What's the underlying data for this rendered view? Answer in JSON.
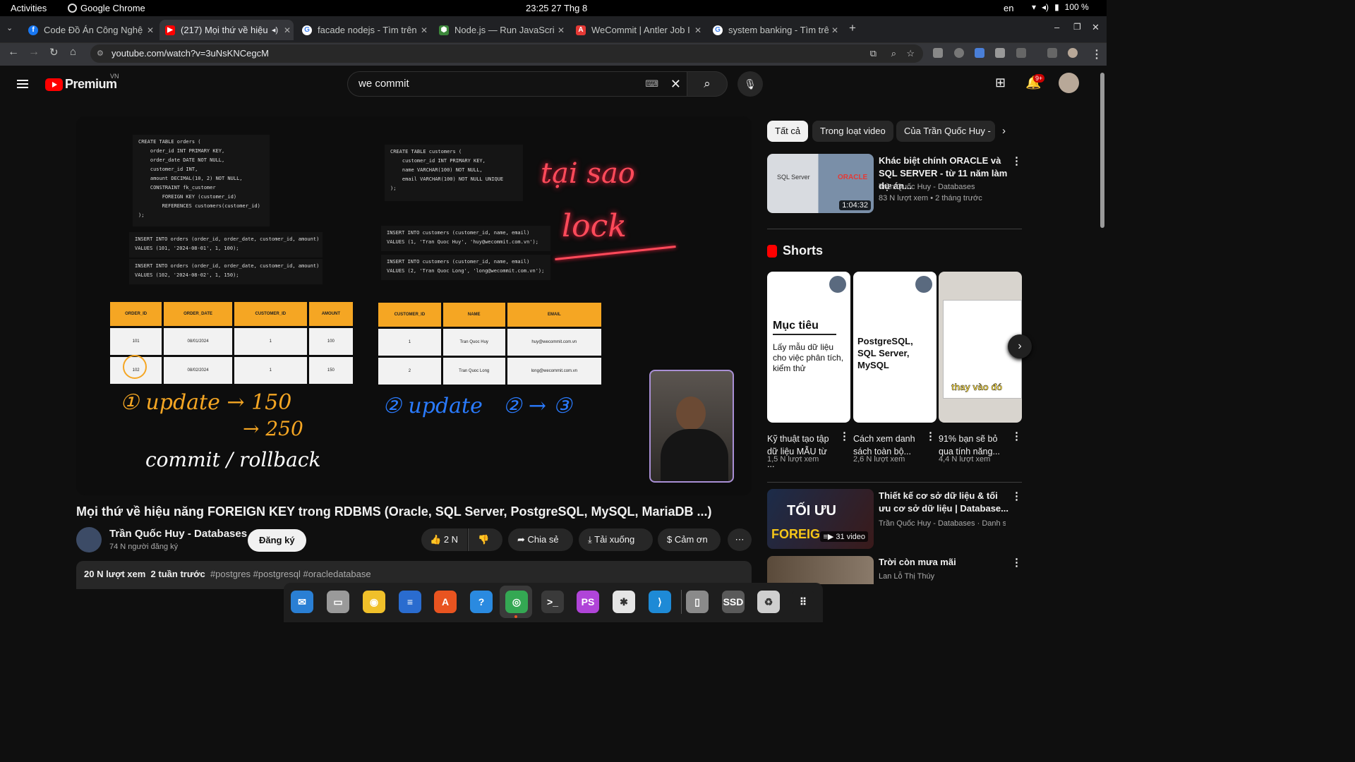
{
  "topbar": {
    "activities": "Activities",
    "app_name": "Google Chrome",
    "clock": "23:25  27 Thg 8",
    "lang": "en",
    "battery": "100 %"
  },
  "tabs": [
    {
      "title": "Code Đồ Án Công Nghệ",
      "favicon": "facebook-icon",
      "color": "#1877f2"
    },
    {
      "title": "(217) Mọi thứ về hiệu",
      "favicon": "youtube-icon",
      "color": "#ff0000"
    },
    {
      "title": "facade nodejs - Tìm trên",
      "favicon": "google-icon",
      "color": "#4285f4"
    },
    {
      "title": "Node.js — Run JavaScrip",
      "favicon": "nodejs-icon",
      "color": "#3c873a"
    },
    {
      "title": "WeCommit | Antler Job I",
      "favicon": "antler-icon",
      "color": "#e53935"
    },
    {
      "title": "system banking - Tìm trê",
      "favicon": "google-icon",
      "color": "#4285f4"
    }
  ],
  "address": {
    "url": "youtube.com/watch?v=3uNsKNCegcM"
  },
  "yt": {
    "brand": "Premium",
    "country": "VN",
    "search_value": "we commit",
    "notif_count": "9+"
  },
  "player": {
    "sql_orders": "CREATE TABLE orders (\n    order_id INT PRIMARY KEY,\n    order_date DATE NOT NULL,\n    customer_id INT,\n    amount DECIMAL(10, 2) NOT NULL,\n    CONSTRAINT fk_customer\n        FOREIGN KEY (customer_id)\n        REFERENCES customers(customer_id)\n);",
    "sql_customers": "CREATE TABLE customers (\n    customer_id INT PRIMARY KEY,\n    name VARCHAR(100) NOT NULL,\n    email VARCHAR(100) NOT NULL UNIQUE\n);",
    "insert_orders_1": "INSERT INTO orders (order_id, order_date, customer_id, amount)\nVALUES (101, '2024-08-01', 1, 100);",
    "insert_orders_2": "INSERT INTO orders (order_id, order_date, customer_id, amount)\nVALUES (102, '2024-08-02', 1, 150);",
    "insert_customers_1": "INSERT INTO customers (customer_id, name, email)\nVALUES (1, 'Tran Quoc Huy', 'huy@wecommit.com.vn');",
    "insert_customers_2": "INSERT INTO customers (customer_id, name, email)\nVALUES (2, 'Tran Quoc Long', 'long@wecommit.com.vn');",
    "orders_headers": [
      "ORDER_ID",
      "ORDER_DATE",
      "CUSTOMER_ID",
      "AMOUNT"
    ],
    "orders_rows": [
      [
        "101",
        "08/01/2024",
        "1",
        "100"
      ],
      [
        "102",
        "08/02/2024",
        "1",
        "150"
      ]
    ],
    "customers_headers": [
      "CUSTOMER_ID",
      "NAME",
      "EMAIL"
    ],
    "customers_rows": [
      [
        "1",
        "Tran Quoc Huy",
        "huy@wecommit.com.vn"
      ],
      [
        "2",
        "Tran Quoc Long",
        "long@wecommit.com.vn"
      ]
    ],
    "handwriting": {
      "red_1": "tại sao",
      "red_2": "lock",
      "orange_1": "① update → 150",
      "orange_2": "→ 250",
      "white": "commit / rollback",
      "blue": "② update   ② → ③"
    }
  },
  "video": {
    "title": "Mọi thứ về hiệu năng FOREIGN KEY trong RDBMS (Oracle, SQL Server, PostgreSQL, MySQL, MariaDB ...)",
    "channel": "Trần Quốc Huy - Databases",
    "subscribers": "74 N người đăng ký",
    "subscribe_label": "Đăng ký",
    "likes": "2 N",
    "share": "Chia sẻ",
    "download": "Tải xuống",
    "thanks": "Cảm ơn",
    "views": "20 N lượt xem",
    "when": "2 tuần trước",
    "hashtags": "#postgres #postgresql #oracledatabase"
  },
  "chips": [
    "Tất cả",
    "Trong loạt video",
    "Của Trần Quốc Huy - "
  ],
  "rec1": {
    "title": "Khác biệt chính ORACLE và SQL SERVER - từ 11 năm làm dự án...",
    "channel": "Trần Quốc Huy - Databases",
    "meta": "83 N lượt xem  •  2 tháng trước",
    "duration": "1:04:32",
    "thumb_left": "SQL Server",
    "thumb_right": "ORACLE"
  },
  "shorts": {
    "heading": "Shorts",
    "items": [
      {
        "card_title": "Mục tiêu",
        "card_body": "Lấy mẫu dữ liệu cho việc phân tích, kiểm thử",
        "title": "Kỹ thuật tạo tập dữ liệu MẪU từ ...",
        "views": "1,5 N lượt xem"
      },
      {
        "card_title": "PostgreSQL, SQL Server, MySQL",
        "card_body": "",
        "title": "Cách xem danh sách toàn bộ...",
        "views": "2,6 N lượt xem"
      },
      {
        "card_title": "thay vào đó",
        "card_body": "",
        "title": "91% bạn sẽ bỏ qua tính năng...",
        "views": "4,4 N lượt xem"
      }
    ]
  },
  "rec2": {
    "title": "Thiết kế cơ sở dữ liệu & tối ưu cơ sở dữ liệu | Database...",
    "meta": "Trần Quốc Huy - Databases · Danh s...",
    "count": "31 video",
    "thumb_text1": "TỐI ƯU",
    "thumb_text2": "FOREIG"
  },
  "rec3": {
    "title": "Trời còn mưa mãi",
    "meta": "Lan Lỗ Thị Thúy"
  },
  "dock": [
    {
      "name": "thunderbird-icon",
      "color": "#2a7fd4",
      "glyph": "✉"
    },
    {
      "name": "files-icon",
      "color": "#9a9a9a",
      "glyph": "▭"
    },
    {
      "name": "rhythmbox-icon",
      "color": "#f0c02a",
      "glyph": "◉"
    },
    {
      "name": "writer-icon",
      "color": "#2a6ccf",
      "glyph": "≡"
    },
    {
      "name": "app-center-icon",
      "color": "#e95420",
      "glyph": "A"
    },
    {
      "name": "help-icon",
      "color": "#2a8ae0",
      "glyph": "?"
    },
    {
      "name": "chrome-icon",
      "color": "#34a853",
      "glyph": "◎"
    },
    {
      "name": "terminal-icon",
      "color": "#3a3a3a",
      "glyph": ">_"
    },
    {
      "name": "phpstorm-icon",
      "color": "#b044d8",
      "glyph": "PS"
    },
    {
      "name": "slack-icon",
      "color": "#e5e5e5",
      "glyph": "✱"
    },
    {
      "name": "vscode-icon",
      "color": "#1e8ad6",
      "glyph": "⟩"
    },
    {
      "name": "drive-icon",
      "color": "#8a8a8a",
      "glyph": "▯"
    },
    {
      "name": "ssd-icon",
      "color": "#5a5a5a",
      "glyph": "SSD"
    },
    {
      "name": "trash-icon",
      "color": "#cfcfcf",
      "glyph": "♻"
    },
    {
      "name": "app-grid-icon",
      "color": "#1e1e1e",
      "glyph": "⠿"
    }
  ]
}
